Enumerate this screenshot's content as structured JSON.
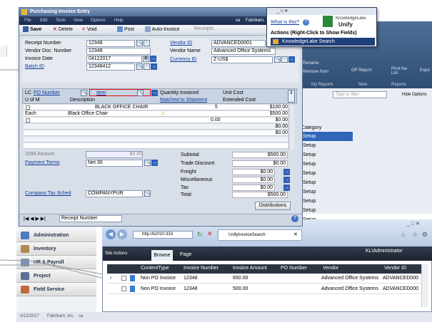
{
  "window": {
    "title": "Purchasing Invoice Entry",
    "user": "sa",
    "company": "Fabrikam,"
  },
  "menu": [
    "File",
    "Edit",
    "Tools",
    "View",
    "Options",
    "Help"
  ],
  "toolbar": {
    "save": "Save",
    "delete": "Delete",
    "void": "Void",
    "post": "Post",
    "auto_invoice": "Auto-Invoice",
    "receipts": "Receipts"
  },
  "header_fields": {
    "receipt_number_label": "Receipt Number",
    "receipt_number": "12348",
    "vendor_doc_label": "Vendor Doc. Number",
    "vendor_doc": "12348",
    "invoice_date_label": "Invoice Date",
    "invoice_date": "04122017",
    "batch_id_label": "Batch ID",
    "batch_id": "12348412",
    "vendor_id_label": "Vendor ID",
    "vendor_id": "ADVANCED0001",
    "vendor_name_label": "Vendor Name",
    "vendor_name": "Advanced Office Systems",
    "currency_id_label": "Currency ID",
    "currency_id": "Z-US$"
  },
  "line_grid": {
    "lc": "LC",
    "po_number": "PO Number",
    "item": "Item",
    "quantity_invoiced": "Quantity Invoiced",
    "unit_cost": "Unit Cost",
    "u_of_m": "U of M",
    "description": "Description",
    "matched_to_shipment": "Matched to Shipment",
    "extended_cost": "Extended Cost",
    "rows": [
      {
        "col1": "",
        "col2": "BLACK OFFICE CHAIR",
        "qty": "5",
        "cost": "$100.00"
      },
      {
        "col1": "Each",
        "col2": "Black Office Chair",
        "qty": "",
        "cost": "$500.00"
      },
      {
        "col1": "",
        "col2": "",
        "qty": "0.00",
        "cost": "$0.00"
      },
      {
        "col1": "",
        "col2": "",
        "qty": "",
        "cost": "$0.00"
      },
      {
        "col1": "",
        "col2": "",
        "qty": "",
        "cost": "$0.00"
      }
    ]
  },
  "totals": {
    "amount_label": "1099 Amount",
    "amount_value": "$0.00",
    "payment_terms_label": "Payment Terms",
    "payment_terms": "Net 30",
    "tax_schedule_label": "Company Tax Sched",
    "tax_schedule": "COMPANYPUR",
    "subtotal_label": "Subtotal",
    "subtotal": "$500.00",
    "trade_discount_label": "Trade Discount",
    "trade_discount": "$0.00",
    "freight_label": "Freight",
    "freight": "$0.00",
    "misc_label": "Miscellaneous",
    "misc": "$0.00",
    "tax_label": "Tax",
    "tax": "$0.00",
    "total_label": "Total",
    "total": "$500.00",
    "distributions": "Distributions"
  },
  "statusbar": {
    "sort": "Receipt Number"
  },
  "popup": {
    "whats_this": "What is this?",
    "logo_line1": "KnowledgeLake",
    "logo_line2": "Unify",
    "actions_header": "Actions (Right-Click to Show Fields)",
    "search_item": "KnowledgeLake Search"
  },
  "right_panel": {
    "ribbon": [
      "Rename",
      "Remove from",
      "GP Report",
      "Print the List",
      "Expo"
    ],
    "group_labels": [
      "My Reports",
      "New",
      "Reports"
    ],
    "filter_placeholder": "Type to filter",
    "hide_options": "Hide Options",
    "category_header": "Category",
    "setup_items": [
      "Setup",
      "Setup",
      "Setup",
      "Setup",
      "Setup",
      "Setup",
      "Setup",
      "Setup",
      "Setup",
      "Setup"
    ]
  },
  "nav_items": [
    "Administration",
    "Inventory",
    "HR & Payroll",
    "Project",
    "Field Service"
  ],
  "browser": {
    "address": "http://k2010:333",
    "tab_title": "UnifyInvoiceSearch",
    "site_actions": "Site Actions",
    "browse_tab": "Browse",
    "page_tab": "Page",
    "user": "KL\\Administrator",
    "columns": [
      "ContentType",
      "Invoice Number",
      "Invoice Amount",
      "PO Number",
      "Vendor",
      "Vendor ID"
    ],
    "rows": [
      {
        "type": "Non PO Invoice",
        "number": "12348",
        "amount": "650.00",
        "po": "",
        "vendor": "Advanced Office Systems",
        "vendor_id": "ADVANCED000"
      },
      {
        "type": "Non PO Invoice",
        "number": "12348",
        "amount": "500.00",
        "po": "",
        "vendor": "Advanced Office Systems",
        "vendor_id": "ADVANCED000"
      }
    ]
  },
  "footer": {
    "date": "4/12/2017",
    "company": "Fabrikam, Inc.",
    "user": "sa"
  }
}
